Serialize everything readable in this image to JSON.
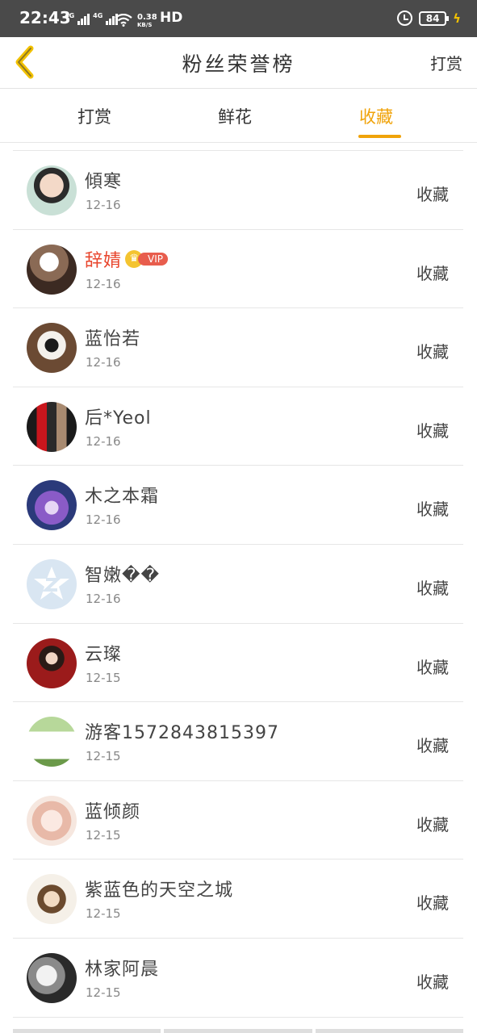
{
  "status_bar": {
    "time": "22:43",
    "net_type_1": "4G",
    "net_type_2": "4G",
    "speed": "0.38",
    "speed_unit": "KB/S",
    "hd": "HD",
    "battery": "84"
  },
  "header": {
    "title": "粉丝荣誉榜",
    "right_action": "打赏",
    "back_icon": "chevron-left-icon",
    "accent_color": "#f0a30a",
    "back_icon_color": "#f2c100"
  },
  "tabs": [
    {
      "label": "打赏",
      "active": false
    },
    {
      "label": "鲜花",
      "active": false
    },
    {
      "label": "收藏",
      "active": true
    }
  ],
  "rows": [
    {
      "name": "傾寒",
      "date": "12-16",
      "action": "收藏",
      "vip": false
    },
    {
      "name": "辞婧",
      "date": "12-16",
      "action": "收藏",
      "vip": true,
      "vip_label": "VIP"
    },
    {
      "name": "蓝怡若",
      "date": "12-16",
      "action": "收藏",
      "vip": false
    },
    {
      "name": "后*Yeol",
      "date": "12-16",
      "action": "收藏",
      "vip": false
    },
    {
      "name": "木之本霜",
      "date": "12-16",
      "action": "收藏",
      "vip": false
    },
    {
      "name": "智嫩��",
      "date": "12-16",
      "action": "收藏",
      "vip": false
    },
    {
      "name": "云璨",
      "date": "12-15",
      "action": "收藏",
      "vip": false
    },
    {
      "name": "游客15728438153​97",
      "date": "12-15",
      "action": "收藏",
      "vip": false
    },
    {
      "name": "蓝倾颜",
      "date": "12-15",
      "action": "收藏",
      "vip": false
    },
    {
      "name": "紫蓝色的天空之城",
      "date": "12-15",
      "action": "收藏",
      "vip": false
    },
    {
      "name": "林家阿晨",
      "date": "12-15",
      "action": "收藏",
      "vip": false
    }
  ]
}
